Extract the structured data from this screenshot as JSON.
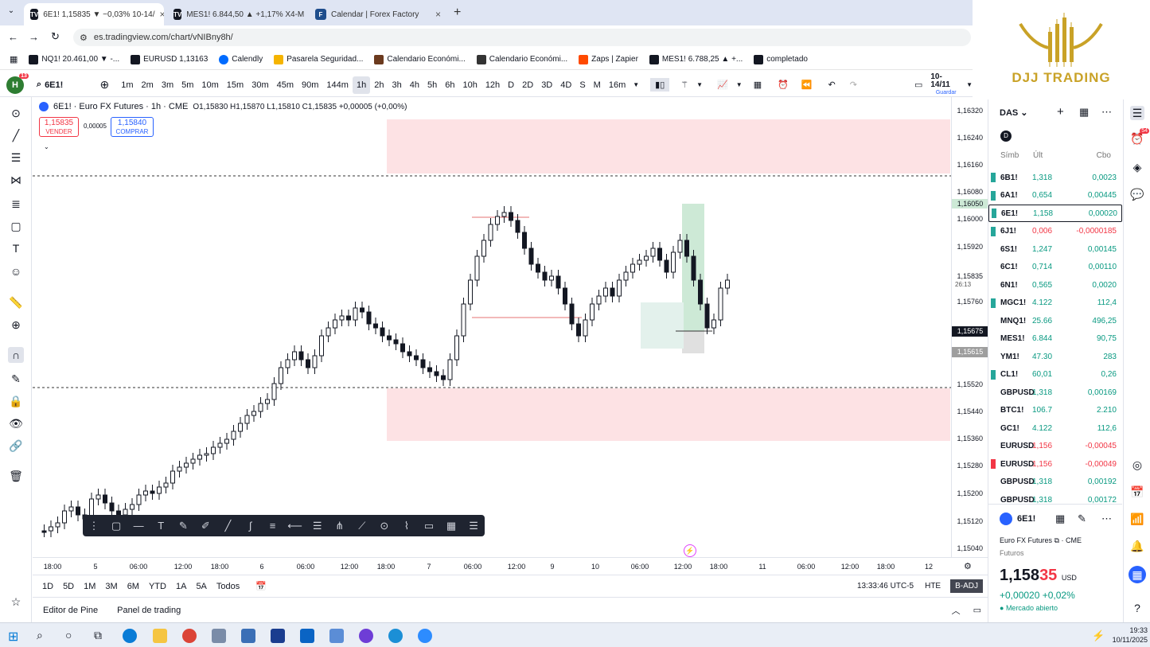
{
  "browser": {
    "tabs": [
      {
        "title": "6E1! 1,15835 ▼ −0,03% 10-14/",
        "active": true
      },
      {
        "title": "MES1! 6.844,50 ▲ +1,17% X4-M",
        "active": false
      },
      {
        "title": "Calendar | Forex Factory",
        "active": false
      }
    ],
    "url": "es.tradingview.com/chart/vNIBny8h/",
    "bookmarks": [
      "NQ1! 20.461,00 ▼ -...",
      "EURUSD 1,13163",
      "Calendly",
      "Pasarela Seguridad...",
      "Calendario Económi...",
      "Calendario Económi...",
      "Zaps | Zapier",
      "MES1! 6.788,25 ▲ +...",
      "completado"
    ]
  },
  "logo": {
    "text": "DJJ TRADING",
    "color": "#c9a227"
  },
  "toolbar": {
    "symbol": "6E1!",
    "timeframes": [
      "1m",
      "2m",
      "3m",
      "5m",
      "10m",
      "15m",
      "30m",
      "45m",
      "90m",
      "144m",
      "1h",
      "2h",
      "3h",
      "4h",
      "5h",
      "6h",
      "10h",
      "12h",
      "D",
      "2D",
      "3D",
      "4D",
      "S",
      "M",
      "16m"
    ],
    "selected_timeframe": "1h",
    "date_label": "10-14/11",
    "save_label": "Guardar"
  },
  "legend": {
    "title": "6E1! · Euro FX Futures · 1h · CME",
    "ohlc": "O1,15830 H1,15870 L1,15810 C1,15835 +0,00005 (+0,00%)",
    "sell_price": "1,15835",
    "sell_label": "VENDER",
    "spread": "0,00005",
    "buy_price": "1,15840",
    "buy_label": "COMPRAR"
  },
  "price_axis": [
    "1,16320",
    "1,16240",
    "1,16160",
    "1,16080",
    "1,16000",
    "1,15920",
    "1,15835",
    "1,15760",
    "1,15675",
    "1,15615",
    "1,15520",
    "1,15440",
    "1,15360",
    "1,15280",
    "1,15200",
    "1,15120",
    "1,15040"
  ],
  "price_badges": {
    "green": "1,16050",
    "current": "1,15675",
    "gray": "1,15615",
    "countdown": "26:13"
  },
  "time_axis": [
    "18:00",
    "5",
    "06:00",
    "12:00",
    "18:00",
    "6",
    "06:00",
    "12:00",
    "18:00",
    "7",
    "06:00",
    "12:00",
    "9",
    "10",
    "06:00",
    "12:00",
    "18:00",
    "11",
    "06:00",
    "12:00",
    "18:00",
    "12"
  ],
  "range": {
    "buttons": [
      "1D",
      "5D",
      "1M",
      "3M",
      "6M",
      "YTD",
      "1A",
      "5A",
      "Todos"
    ],
    "clock": "13:33:46 UTC-5",
    "session": "HTE",
    "badj": "B-ADJ"
  },
  "bottom_tabs": [
    "Editor de Pine",
    "Panel de trading"
  ],
  "watchlist": {
    "name": "DAS",
    "section": "D",
    "headers": [
      "Símb",
      "Últ",
      "Cbo"
    ],
    "rows": [
      {
        "sym": "6B1!",
        "last": "1,318",
        "chg": "0,0023",
        "color": "#089981",
        "flag": "#26a69a"
      },
      {
        "sym": "6A1!",
        "last": "0,654",
        "chg": "0,00445",
        "color": "#089981",
        "flag": "#26a69a"
      },
      {
        "sym": "6E1!",
        "last": "1,158",
        "chg": "0,00020",
        "color": "#089981",
        "flag": "#26a69a"
      },
      {
        "sym": "6J1!",
        "last": "0,006",
        "chg": "-0,0000185",
        "color": "#f23645",
        "flag": "#26a69a"
      },
      {
        "sym": "6S1!",
        "last": "1,247",
        "chg": "0,00145",
        "color": "#089981",
        "flag": ""
      },
      {
        "sym": "6C1!",
        "last": "0,714",
        "chg": "0,00110",
        "color": "#089981",
        "flag": ""
      },
      {
        "sym": "6N1!",
        "last": "0,565",
        "chg": "0,0020",
        "color": "#089981",
        "flag": ""
      },
      {
        "sym": "MGC1!",
        "last": "4.122",
        "chg": "112,4",
        "color": "#089981",
        "flag": "#26a69a"
      },
      {
        "sym": "MNQ1!",
        "last": "25.66",
        "chg": "496,25",
        "color": "#089981",
        "flag": ""
      },
      {
        "sym": "MES1!",
        "last": "6.844",
        "chg": "90,75",
        "color": "#089981",
        "flag": ""
      },
      {
        "sym": "YM1!",
        "last": "47.30",
        "chg": "283",
        "color": "#089981",
        "flag": ""
      },
      {
        "sym": "CL1!",
        "last": "60,01",
        "chg": "0,26",
        "color": "#089981",
        "flag": "#26a69a"
      },
      {
        "sym": "GBPUSD",
        "last": "1,318",
        "chg": "0,00169",
        "color": "#089981",
        "flag": ""
      },
      {
        "sym": "BTC1!",
        "last": "106.7",
        "chg": "2.210",
        "color": "#089981",
        "flag": ""
      },
      {
        "sym": "GC1!",
        "last": "4.122",
        "chg": "112,6",
        "color": "#089981",
        "flag": ""
      },
      {
        "sym": "EURUSD",
        "last": "1,156",
        "chg": "-0,00045",
        "color": "#f23645",
        "flag": ""
      },
      {
        "sym": "EURUSD",
        "last": "1,156",
        "chg": "-0,00049",
        "color": "#f23645",
        "flag": "#f23645"
      },
      {
        "sym": "GBPUSD",
        "last": "1,318",
        "chg": "0,00192",
        "color": "#089981",
        "flag": ""
      },
      {
        "sym": "GBPUSD",
        "last": "1,318",
        "chg": "0,00172",
        "color": "#089981",
        "flag": ""
      }
    ]
  },
  "detail": {
    "symbol": "6E1!",
    "name": "Euro FX Futures",
    "exchange": "CME",
    "type": "Futuros",
    "price_main": "1,158",
    "price_tail": "35",
    "currency": "USD",
    "change": "+0,00020",
    "change_pct": "+0,02%",
    "market_status": "Mercado abierto",
    "alert_badge": "54"
  },
  "taskbar": {
    "time": "19:33",
    "date": "10/11/2025"
  },
  "colors": {
    "accent": "#2962ff",
    "up": "#089981",
    "down": "#f23645",
    "zone": "#fde2e4"
  }
}
